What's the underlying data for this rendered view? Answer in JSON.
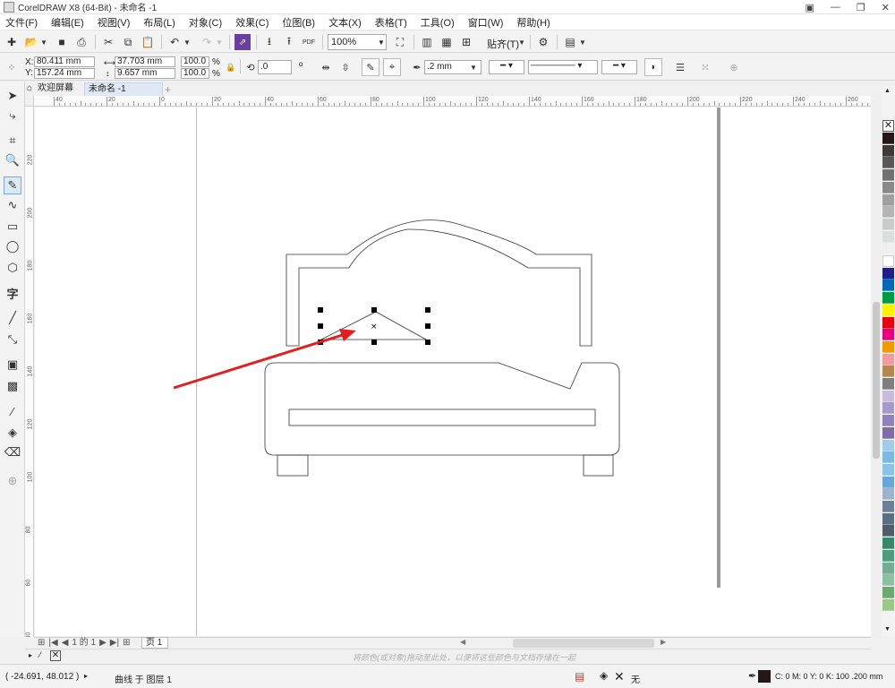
{
  "window": {
    "title": "CorelDRAW X8 (64-Bit) - 未命名 -1"
  },
  "menu": [
    "文件(F)",
    "编辑(E)",
    "视图(V)",
    "布局(L)",
    "对象(C)",
    "效果(C)",
    "位图(B)",
    "文本(X)",
    "表格(T)",
    "工具(O)",
    "窗口(W)",
    "帮助(H)"
  ],
  "toolbar": {
    "zoom": "100%",
    "snap_label": "贴齐(T)",
    "pdf_label": "PDF"
  },
  "propbar": {
    "x_label": "X:",
    "x_value": "80.411 mm",
    "y_label": "Y:",
    "y_value": "157.24 mm",
    "width_value": "37.703 mm",
    "height_value": "9.657 mm",
    "scale_w": "100.0",
    "scale_h": "100.0",
    "percent": "%",
    "rotation": ".0",
    "degree_symbol": "o",
    "outline_width": ".2 mm"
  },
  "tabs": {
    "welcome": "欢迎屏幕",
    "document": "未命名 -1"
  },
  "ruler_h": [
    "40",
    "20",
    "0",
    "20",
    "40",
    "60",
    "80",
    "100",
    "120",
    "140",
    "160",
    "180",
    "200",
    "220",
    "240",
    "260"
  ],
  "ruler_v": [
    "220",
    "200",
    "180",
    "160",
    "140",
    "120",
    "100",
    "80",
    "60",
    "40"
  ],
  "pagebar": {
    "page_count": "1 的 1",
    "page_tab": "页 1"
  },
  "hint": "将颜色(或对象)拖动至此处，以便将这些颜色与文档存储在一起",
  "status": {
    "coords": "( -24.691, 48.012 )",
    "object_info": "曲线 于 图层 1",
    "fill_none": "无",
    "outline_info": "C: 0 M: 0 Y: 0 K: 100  .200 mm"
  },
  "palette_colors": [
    "#231815",
    "#3e3a39",
    "#595757",
    "#727171",
    "#898989",
    "#9fa0a0",
    "#b5b5b6",
    "#c9caca",
    "#dcdddd",
    "#efefef",
    "#ffffff",
    "#1d2088",
    "#0068b7",
    "#009944",
    "#fff100",
    "#e60012",
    "#e4007f",
    "#f39800",
    "#f29c9f",
    "#b28850",
    "#7f7f7f",
    "#c9bbdb",
    "#a59aca",
    "#8f82bc",
    "#7e6ca8",
    "#a1cbe8",
    "#7ab9e0",
    "#89c3eb",
    "#68a5d9",
    "#9db2cf",
    "#6c7f99",
    "#5a6e84",
    "#4e5c6b",
    "#39876b",
    "#4b9b7c",
    "#70ad91",
    "#8cc0a2",
    "#6aaa72",
    "#97c885"
  ],
  "accent_colors": {
    "arrow": "#e02020",
    "active_tool": "#dce9f7",
    "statusbar_outline": "#231815"
  },
  "icons": [
    "select-tool-icon",
    "shape-tool-icon",
    "crop-tool-icon",
    "zoom-tool-icon",
    "freehand-tool-icon",
    "artistic-media-icon",
    "rectangle-tool-icon",
    "ellipse-tool-icon",
    "polygon-tool-icon",
    "text-tool-icon",
    "parallel-dimension-icon",
    "connector-icon",
    "drop-shadow-icon",
    "transparency-icon",
    "eyedropper-icon",
    "interactive-fill-icon",
    "smart-fill-icon",
    "add-tool-icon"
  ]
}
